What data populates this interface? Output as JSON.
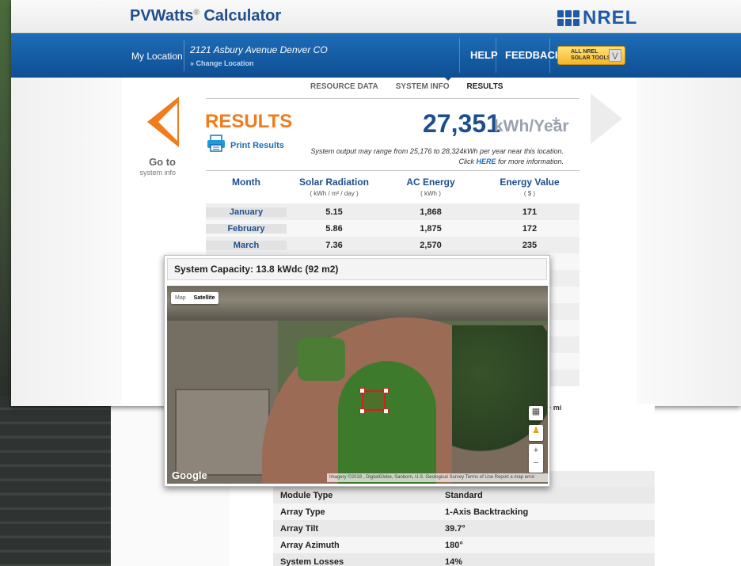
{
  "brand": {
    "name": "PVWatts",
    "reg": "®",
    "suffix": " Calculator",
    "org_logo": "NREL"
  },
  "nav": {
    "location_label": "My Location",
    "address": "2121 Asbury Avenue Denver CO",
    "change_location": "» Change Location",
    "help": "HELP",
    "feedback": "FEEDBACK",
    "tools_line1": "ALL NREL",
    "tools_line2": "SOLAR TOOLS",
    "tools_icon": "chevron-down-icon"
  },
  "sidebar": {
    "go_to": "Go to",
    "go_to_sub": "system info"
  },
  "tabs": [
    {
      "label": "RESOURCE DATA"
    },
    {
      "label": "SYSTEM INFO"
    },
    {
      "label": "RESULTS"
    }
  ],
  "results": {
    "title": "RESULTS",
    "print_label": "Print Results",
    "annual_value": "27,351",
    "annual_unit": "kWh/Year",
    "annual_star": "*",
    "range_note": "System output may range from 25,176 to 28,324kWh per year near this location.",
    "click": "Click ",
    "here": "HERE",
    "more_info": " for more information."
  },
  "table": {
    "headers": [
      {
        "label": "Month",
        "sub": ""
      },
      {
        "label": "Solar Radiation",
        "sub": "( kWh / m² / day )"
      },
      {
        "label": "AC Energy",
        "sub": "( kWh )"
      },
      {
        "label": "Energy Value",
        "sub": "( $ )"
      }
    ],
    "rows": [
      {
        "month": "January",
        "radiation": "5.15",
        "ac": "1,868",
        "value": "171"
      },
      {
        "month": "February",
        "radiation": "5.86",
        "ac": "1,875",
        "value": "172"
      },
      {
        "month": "March",
        "radiation": "7.36",
        "ac": "2,570",
        "value": "235"
      }
    ]
  },
  "map": {
    "title": "System Capacity: 13.8 kWdc (92 m2)",
    "type_map": "Map",
    "type_satellite": "Satellite",
    "google": "Google",
    "attribution": "Imagery ©2018 , DigitalGlobe, Sanborn, U.S. Geological Survey   Terms of Use   Report a map error",
    "zoom_in": "+",
    "zoom_out": "−"
  },
  "system_info": {
    "peek_text": "+ mi",
    "rows": [
      {
        "key": "Module Type",
        "value": "Standard"
      },
      {
        "key": "Array Type",
        "value": "1-Axis Backtracking"
      },
      {
        "key": "Array Tilt",
        "value": "39.7°"
      },
      {
        "key": "Array Azimuth",
        "value": "180°"
      },
      {
        "key": "System Losses",
        "value": "14%"
      }
    ]
  },
  "colors": {
    "brand_blue": "#1d4f8c",
    "nav_blue": "#1d6db7",
    "accent_orange": "#f07c1c"
  }
}
